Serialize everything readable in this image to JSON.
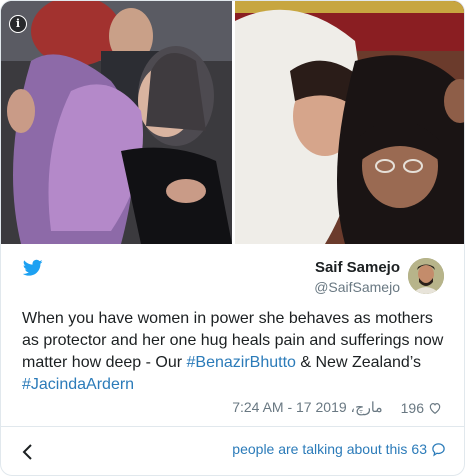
{
  "media": {
    "info_icon": "i",
    "photos": [
      "jacinda-ardern-hug",
      "benazir-bhutto-hug"
    ]
  },
  "author": {
    "name": "Saif Samejo",
    "handle": "@SaifSamejo"
  },
  "tweet": {
    "text_part1": "When you have women in power she behaves as mothers as protector and her one hug heals pain and sufferings now matter how deep - Our ",
    "tag1": "#BenazirBhutto",
    "text_part2": " & New Zealand’s ",
    "tag2": "#JacindaArdern"
  },
  "meta": {
    "timestamp": "7:24 AM - 17 مارچ، 2019",
    "likes": "196"
  },
  "footer": {
    "talking_label": "people are talking about this",
    "talking_count": "63"
  },
  "colors": {
    "link": "#2b7bb9",
    "muted": "#697882",
    "twitter_blue": "#1da1f2",
    "border": "#e1e8ed"
  },
  "icons": {
    "info": "info-icon",
    "bird": "twitter-bird-icon",
    "heart": "heart-icon",
    "back": "chevron-left-icon",
    "bubble": "chat-bubble-icon"
  }
}
